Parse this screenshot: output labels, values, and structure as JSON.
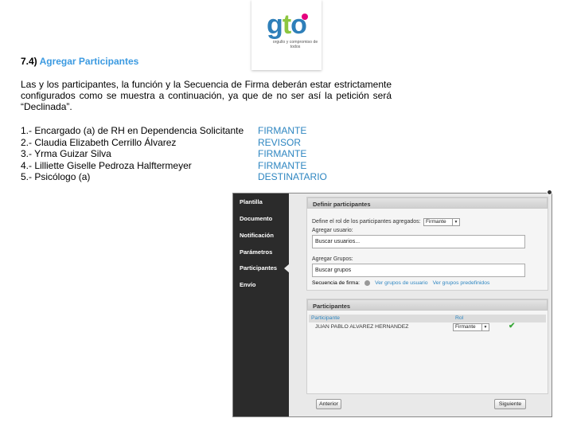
{
  "logo": {
    "word_g": "g",
    "word_t": "t",
    "word_o": "o",
    "tagline": "orgullo y compromiso de todos",
    "colors": {
      "blue": "#2e7fb9",
      "green": "#8cc63f",
      "pink": "#e5007e"
    }
  },
  "document": {
    "heading_number": "7.4)",
    "heading_link": "Agregar Participantes",
    "paragraph": "Las y los participantes, la función y la Secuencia de Firma deberán estar estrictamente configurados como se muestra a continuación, ya que de no ser así la petición será “Declinada”.",
    "participants": [
      {
        "who": "1.- Encargado (a) de RH en Dependencia Solicitante",
        "role": "FIRMANTE"
      },
      {
        "who": "2.- Claudia Elizabeth Cerrillo Álvarez",
        "role": "REVISOR"
      },
      {
        "who": "3.- Yrma Guizar Silva",
        "role": "FIRMANTE"
      },
      {
        "who": "4.- Lilliette Giselle Pedroza Halftermeyer",
        "role": "FIRMANTE"
      },
      {
        "who": "5.- Psicólogo (a)",
        "role": "DESTINATARIO"
      }
    ],
    "colors": {
      "link": "#3b9ae1",
      "role": "#2e86c1"
    }
  },
  "app": {
    "sidebar": [
      {
        "label": "Plantilla"
      },
      {
        "label": "Documento"
      },
      {
        "label": "Notificación"
      },
      {
        "label": "Parámetros"
      },
      {
        "label": "Participantes",
        "active": true
      },
      {
        "label": "Envío"
      }
    ],
    "define_panel": {
      "title": "Definir participantes",
      "role_label": "Define el rol de los participantes agregados:",
      "role_value": "Firmante",
      "add_user_label": "Agregar usuario:",
      "add_user_placeholder": "Buscar usuarios...",
      "add_group_label": "Agregar Grupos:",
      "add_group_placeholder": "Buscar grupos",
      "sequence_label": "Secuencia de firma:",
      "link_user_groups": "Ver grupos de usuario",
      "link_predefined_groups": "Ver grupos predefinidos"
    },
    "participants_panel": {
      "title": "Participantes",
      "columns": [
        "Participante",
        "Rol"
      ],
      "rows": [
        {
          "name": "JUAN PABLO ALVAREZ HERNANDEZ",
          "role": "Firmante"
        }
      ]
    },
    "buttons": {
      "prev": "Anterior",
      "next": "Siguiente"
    }
  }
}
